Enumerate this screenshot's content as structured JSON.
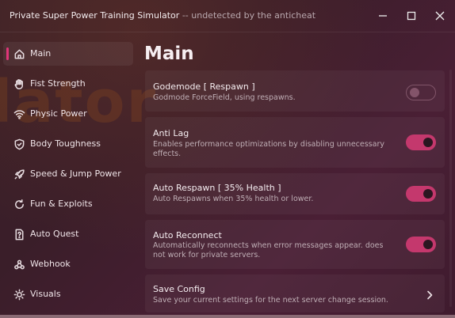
{
  "window": {
    "title": "Private Super Power Training Simulator",
    "subtitle": "-- undetected by the anticheat",
    "watermark": "lator"
  },
  "sidebar": {
    "items": [
      {
        "label": "Main",
        "icon": "home-icon",
        "active": true
      },
      {
        "label": "Fist Strength",
        "icon": "hand-icon"
      },
      {
        "label": "Physic Power",
        "icon": "wifi-icon"
      },
      {
        "label": "Body Toughness",
        "icon": "shield-icon"
      },
      {
        "label": "Speed & Jump Power",
        "icon": "rocket-icon"
      },
      {
        "label": "Fun & Exploits",
        "icon": "refresh-icon"
      },
      {
        "label": "Auto Quest",
        "icon": "help-file-icon"
      },
      {
        "label": "Webhook",
        "icon": "webhook-icon"
      },
      {
        "label": "Visuals",
        "icon": "sun-icon"
      }
    ]
  },
  "main": {
    "title": "Main",
    "cards": [
      {
        "title": "Godemode [ Respawn ]",
        "desc": "Godmode ForceField, using respawns.",
        "toggle": false
      },
      {
        "title": "Anti Lag",
        "desc": "Enables performance optimizations by disabling unnecessary effects.",
        "toggle": true
      },
      {
        "title": "Auto Respawn [ 35% Health ]",
        "desc": "Auto Respawns when 35% health or lower.",
        "toggle": true
      },
      {
        "title": "Auto Reconnect",
        "desc": "Automatically reconnects when error messages appear. does not work for private servers.",
        "toggle": true
      },
      {
        "title": "Save Config",
        "desc": "Save your current settings for the next server change session."
      }
    ]
  },
  "colors": {
    "accent": "#e0357a",
    "toggle_on": "#c4386d",
    "background": "#3a1e29"
  }
}
